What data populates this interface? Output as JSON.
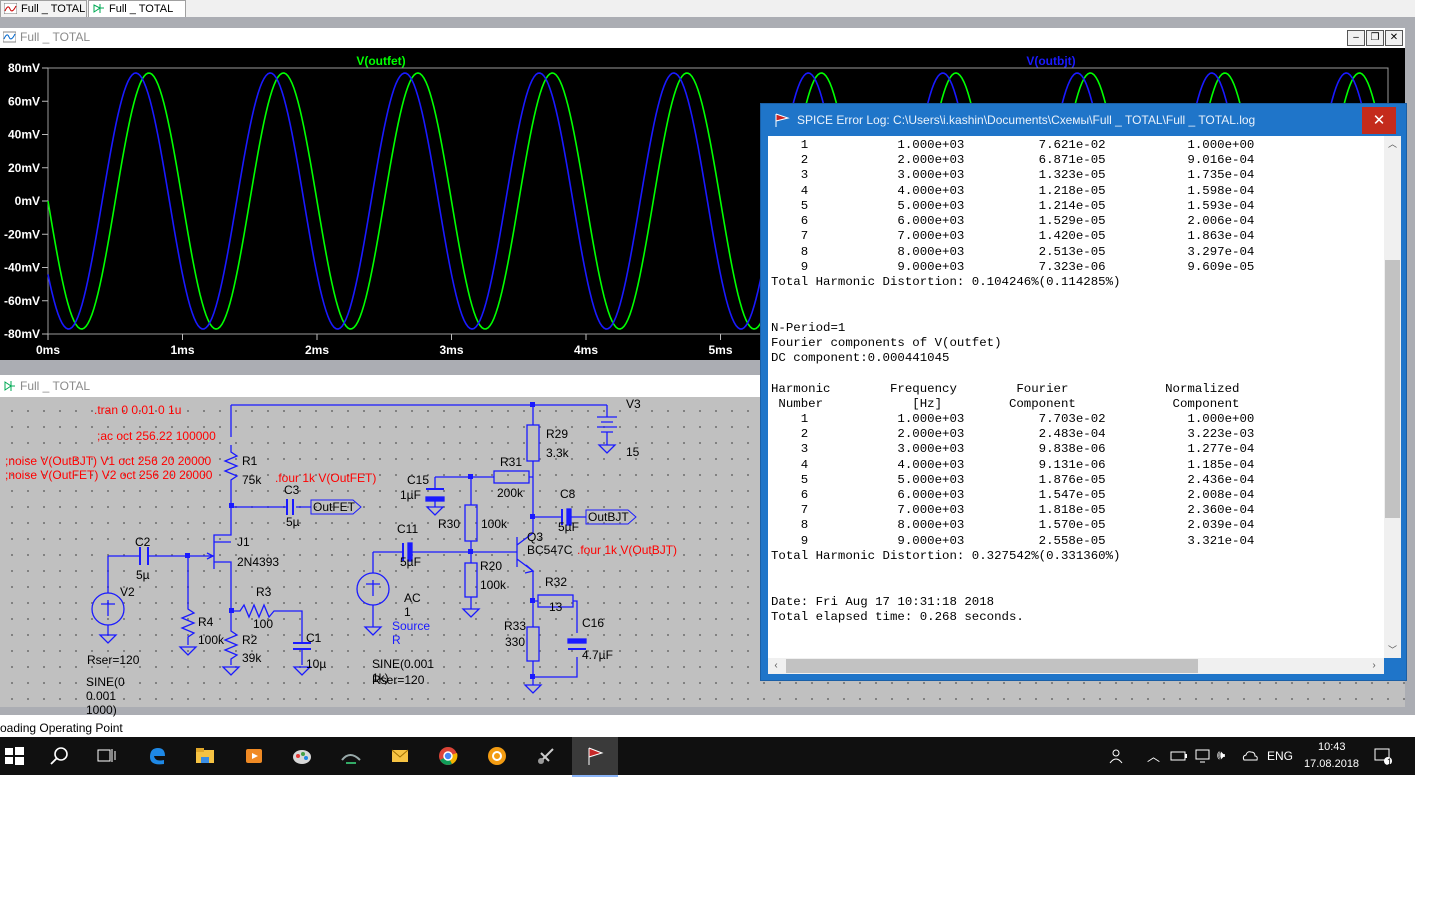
{
  "tabs": [
    {
      "label": "Full _ TOTAL",
      "icon": "waveform-icon"
    },
    {
      "label": "Full _ TOTAL",
      "icon": "schematic-icon"
    }
  ],
  "plot_window": {
    "title": "Full _ TOTAL",
    "buttons": [
      "minimize",
      "restore",
      "close"
    ]
  },
  "schematic_window": {
    "title": "Full _ TOTAL"
  },
  "chart_data": {
    "type": "line",
    "xlabel": "",
    "ylabel": "",
    "x_ticks": [
      "0ms",
      "1ms",
      "2ms",
      "3ms",
      "4ms",
      "5ms"
    ],
    "y_ticks": [
      "80mV",
      "60mV",
      "40mV",
      "20mV",
      "0mV",
      "-20mV",
      "-40mV",
      "-60mV",
      "-80mV"
    ],
    "xlim": [
      0,
      10
    ],
    "ylim": [
      -80,
      80
    ],
    "series": [
      {
        "name": "V(outfet)",
        "color": "#00ff00",
        "amplitude": 77,
        "frequency_khz": 1,
        "phase_deg": 180
      },
      {
        "name": "V(outbjt)",
        "color": "#1a1aff",
        "amplitude": 77,
        "frequency_khz": 1,
        "phase_deg": 215
      }
    ]
  },
  "schematic": {
    "directives": {
      "tran": ".tran 0 0.01 0 1u",
      "ac": ";ac oct 256.22 100000",
      "noise1": ";noise V(OutBJT) V1 oct 256 20 20000",
      "noise2": ";noise V(OutFET) V2 oct 256 20 20000",
      "four_fet": ".four 1k V(OutFET)",
      "four_bjt": ".four 1k V(OutBJT)"
    },
    "labels": {
      "R1": "R1",
      "R1v": "75k",
      "C3": "C3",
      "C3v": "5µ",
      "outfet": "OutFET",
      "J1": "J1",
      "J1v": "2N4393",
      "C2": "C2",
      "C2v": "5µ",
      "V2": "V2",
      "R4": "R4",
      "R4v": "100k",
      "R3": "R3",
      "R3v": "100",
      "R2": "R2",
      "R2v": "39k",
      "C1": "C1",
      "C1v": "10µ",
      "rser1": "Rser=120",
      "sine1": "SINE(0 0.001 1000)",
      "V3": "V3",
      "V3v": "15",
      "R29": "R29",
      "R29v": "3.3k",
      "R31": "R31",
      "R31v": "200k",
      "C15": "C15",
      "C15v": "1µF",
      "R30": "R30",
      "R30v": "100k",
      "C8": "C8",
      "C8v": "5µF",
      "outbjt": "OutBJT",
      "C11": "C11",
      "C11v": "5µF",
      "Q3": "Q3",
      "Q3v": "BC547C",
      "R20": "R20",
      "R20v": "100k",
      "R32": "R32",
      "R32v": "13",
      "R33": "R33",
      "R33v": "330",
      "C16": "C16",
      "C16v": "4.7µF",
      "ac1": "AC 1",
      "sourceR": "Source R",
      "sine2": "SINE(0.001 1k)",
      "rser2": "Rser=120"
    }
  },
  "error_log": {
    "title": "SPICE Error Log: C:\\Users\\i.kashin\\Documents\\Схемы\\Full _ TOTAL\\Full _ TOTAL.log",
    "lines": [
      "    1            1.000e+03          7.621e-02           1.000e+00",
      "    2            2.000e+03          6.871e-05           9.016e-04",
      "    3            3.000e+03          1.323e-05           1.735e-04",
      "    4            4.000e+03          1.218e-05           1.598e-04",
      "    5            5.000e+03          1.214e-05           1.593e-04",
      "    6            6.000e+03          1.529e-05           2.006e-04",
      "    7            7.000e+03          1.420e-05           1.863e-04",
      "    8            8.000e+03          2.513e-05           3.297e-04",
      "    9            9.000e+03          7.323e-06           9.609e-05",
      "Total Harmonic Distortion: 0.104246%(0.114285%)",
      "",
      "",
      "N-Period=1",
      "Fourier components of V(outfet)",
      "DC component:0.000441045",
      "",
      "Harmonic        Frequency        Fourier             Normalized",
      " Number            [Hz]         Component             Component",
      "    1            1.000e+03          7.703e-02           1.000e+00",
      "    2            2.000e+03          2.483e-04           3.223e-03",
      "    3            3.000e+03          9.838e-06           1.277e-04",
      "    4            4.000e+03          9.131e-06           1.185e-04",
      "    5            5.000e+03          1.876e-05           2.436e-04",
      "    6            6.000e+03          1.547e-05           2.008e-04",
      "    7            7.000e+03          1.818e-05           2.360e-04",
      "    8            8.000e+03          1.570e-05           2.039e-04",
      "    9            9.000e+03          2.558e-05           3.321e-04",
      "Total Harmonic Distortion: 0.327542%(0.331360%)",
      "",
      "",
      "Date: Fri Aug 17 10:31:18 2018",
      "Total elapsed time: 0.268 seconds."
    ]
  },
  "status_text": "oading Operating Point",
  "taskbar": {
    "apps": [
      "start-icon",
      "search-icon",
      "task-view-icon",
      "edge-icon",
      "file-explorer-icon",
      "media-player-icon",
      "paint-icon",
      "ltspice-icon",
      "mail-icon",
      "chrome-icon",
      "app-orange-icon",
      "satellite-icon",
      "ltspice-active-icon"
    ],
    "language": "ENG",
    "time": "10:43",
    "date": "17.08.2018",
    "notification_count": "1"
  }
}
